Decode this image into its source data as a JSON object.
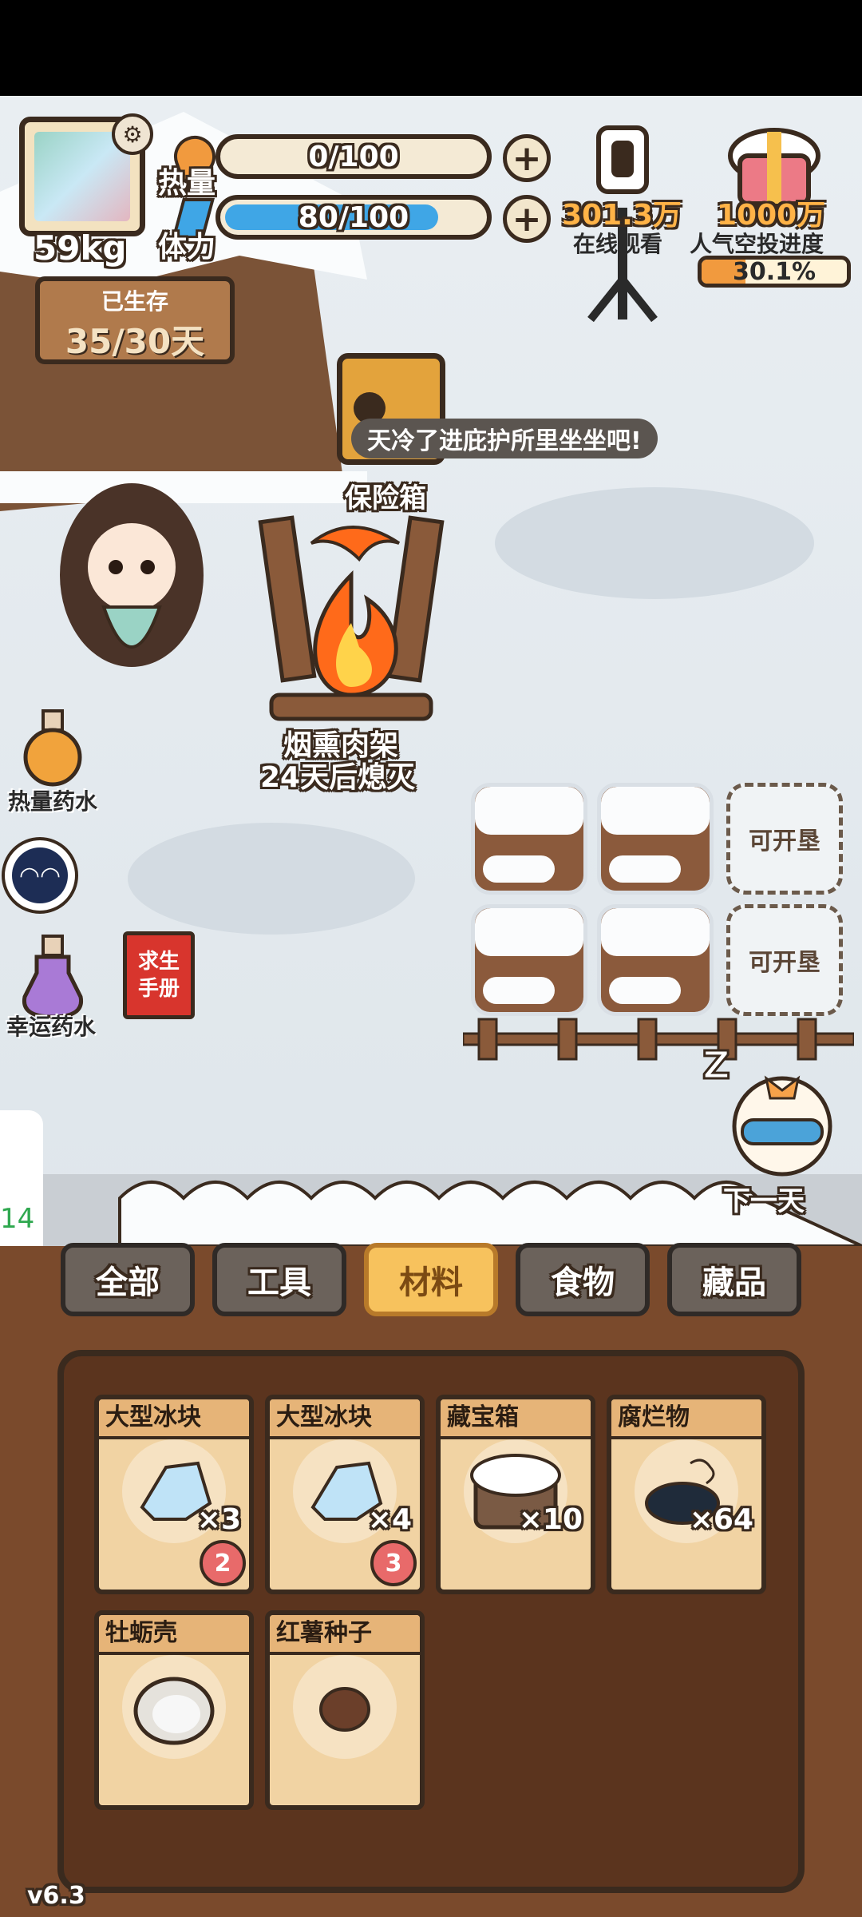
{
  "player": {
    "weight": "59kg",
    "survived_label": "已生存",
    "survived_value": "35/30天"
  },
  "stats": {
    "heat": {
      "label": "热量",
      "value_text": "0/100",
      "fraction": 0.0
    },
    "stamina": {
      "label": "体力",
      "value_text": "80/100",
      "fraction": 0.8
    }
  },
  "stream": {
    "viewers_value": "301.3万",
    "viewers_label": "在线观看",
    "airdrop_value": "1000万",
    "airdrop_label": "人气空投进度",
    "airdrop_percent": "30.1%",
    "airdrop_fraction": 0.301
  },
  "world": {
    "safe_label": "保险箱",
    "hint_bubble": "天冷了进庇护所里坐坐吧!",
    "smoker_label": "烟熏肉架",
    "smoker_status": "24天后熄灭",
    "heat_potion": "热量药水",
    "luck_potion": "幸运药水",
    "manual": "求生\n手册",
    "next_day": "下一天",
    "side_number": "14",
    "plot_locked_label": "可开垦",
    "version": "v6.3"
  },
  "tabs": [
    {
      "label": "全部",
      "active": false
    },
    {
      "label": "工具",
      "active": false
    },
    {
      "label": "材料",
      "active": true
    },
    {
      "label": "食物",
      "active": false
    },
    {
      "label": "藏品",
      "active": false
    }
  ],
  "inventory": [
    {
      "name": "大型冰块",
      "qty": "×3",
      "badge": "2",
      "icon": "ice-icon"
    },
    {
      "name": "大型冰块",
      "qty": "×4",
      "badge": "3",
      "icon": "ice-icon"
    },
    {
      "name": "藏宝箱",
      "qty": "×10",
      "badge": "",
      "icon": "treasure-chest-icon"
    },
    {
      "name": "腐烂物",
      "qty": "×64",
      "badge": "",
      "icon": "rotten-item-icon"
    },
    {
      "name": "牡蛎壳",
      "qty": "",
      "badge": "",
      "icon": "oyster-shell-icon"
    },
    {
      "name": "红薯种子",
      "qty": "",
      "badge": "",
      "icon": "sweet-potato-seed-icon"
    }
  ],
  "colors": {
    "stamina_fill": "#3fa6e6",
    "active_tab": "#f7c25d",
    "panel_wood": "#7a4a2c"
  }
}
